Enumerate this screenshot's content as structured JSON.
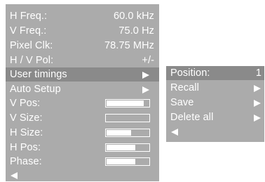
{
  "main_menu": {
    "info": [
      {
        "label": "H Freq.:",
        "value": "60.0 kHz"
      },
      {
        "label": "V Freq.:",
        "value": "75.0 Hz"
      },
      {
        "label": "Pixel Clk:",
        "value": "78.75 MHz"
      },
      {
        "label": "H / V Pol:",
        "value": "+/-"
      }
    ],
    "user_timings_label": "User timings",
    "auto_setup_label": "Auto Setup",
    "sliders": [
      {
        "label": "V Pos:",
        "level": 0.88
      },
      {
        "label": "V Size:",
        "level": 0.0
      },
      {
        "label": "H Size:",
        "level": 0.58
      },
      {
        "label": "H Pos:",
        "level": 0.68
      },
      {
        "label": "Phase:",
        "level": 0.68
      }
    ],
    "back_icon": "left-arrow-icon"
  },
  "sub_menu": {
    "position_label": "Position:",
    "position_value": "1",
    "items": [
      {
        "label": "Recall"
      },
      {
        "label": "Save"
      },
      {
        "label": "Delete all"
      }
    ],
    "back_icon": "left-arrow-icon"
  },
  "colors": {
    "panel": "#ababab",
    "highlight": "#8a8a8a",
    "text": "#ffffff"
  }
}
